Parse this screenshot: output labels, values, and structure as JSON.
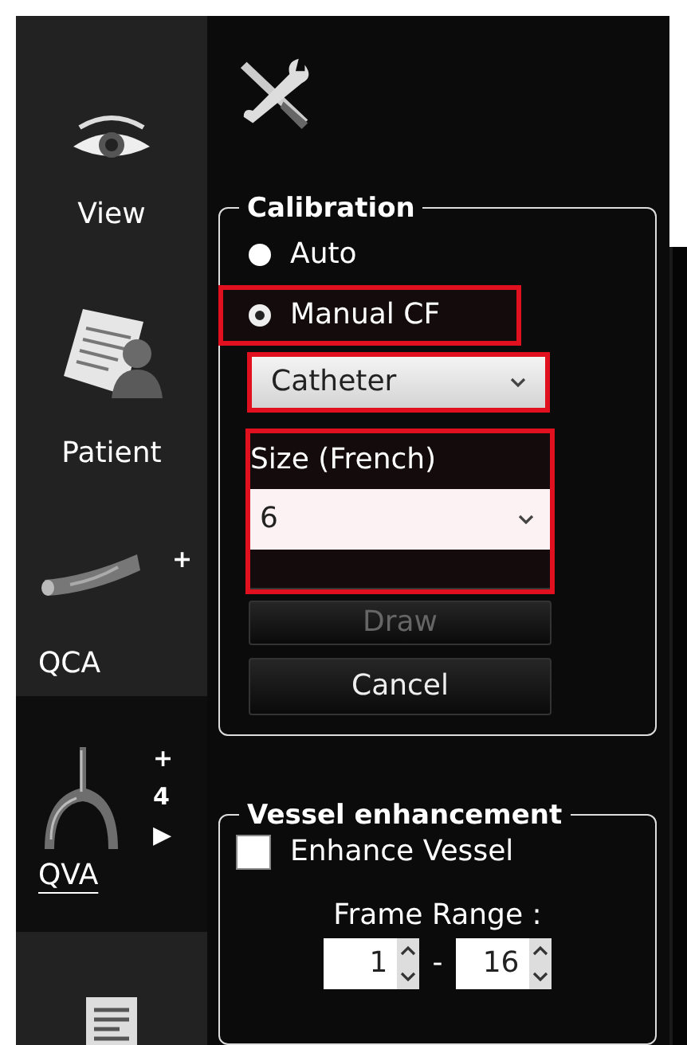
{
  "sidebar": {
    "items": [
      {
        "kind": "eye",
        "label": "View",
        "selected": false
      },
      {
        "kind": "patient",
        "label": "Patient",
        "selected": false
      },
      {
        "kind": "vessel",
        "label": "QCA",
        "badges": [
          "+"
        ],
        "selected": false
      },
      {
        "kind": "bifurcation",
        "label": "QVA",
        "badges": [
          "+",
          "4",
          "▶"
        ],
        "selected": true
      },
      {
        "kind": "document",
        "selected": false
      }
    ]
  },
  "calibration": {
    "title": "Calibration",
    "options": [
      {
        "label": "Auto",
        "selected": false,
        "highlighted": false
      },
      {
        "label": "Manual CF",
        "selected": true,
        "highlighted": true
      }
    ],
    "type_select": {
      "value": "Catheter",
      "highlighted": true
    },
    "size": {
      "label": "Size (French)",
      "value": "6",
      "highlighted": true
    },
    "buttons": [
      {
        "label": "Draw",
        "disabled": true
      },
      {
        "label": "Cancel",
        "disabled": false
      }
    ]
  },
  "vessel_enhancement": {
    "title": "Vessel enhancement",
    "checkbox": {
      "label": "Enhance Vessel",
      "checked": false
    },
    "frame_range": {
      "label": "Frame Range :",
      "from": "1",
      "separator": "-",
      "to": "16"
    }
  }
}
